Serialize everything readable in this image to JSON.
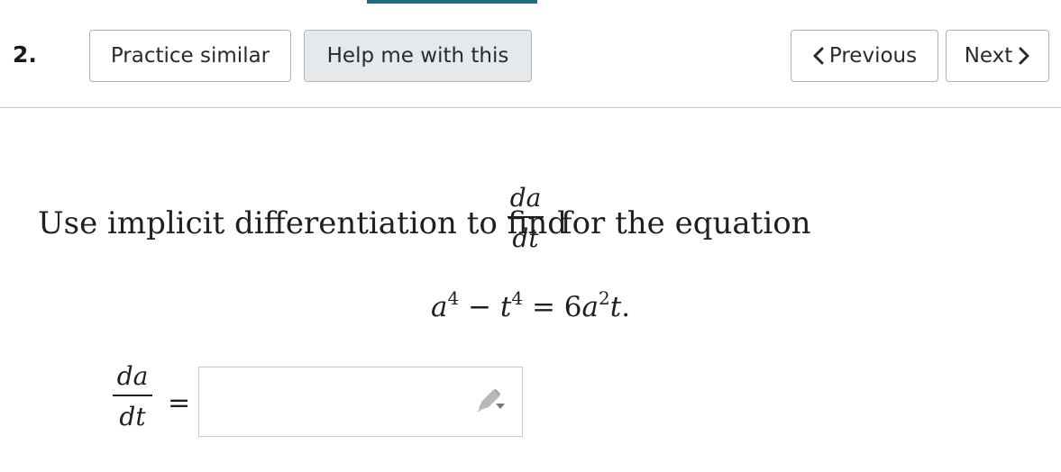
{
  "question": {
    "number": "2."
  },
  "toolbar": {
    "practice_label": "Practice similar",
    "help_label": "Help me with this",
    "previous_label": "Previous",
    "next_label": "Next",
    "previous_icon": "chevron-left-icon",
    "next_icon": "chevron-right-icon"
  },
  "problem": {
    "prompt_before": "Use implicit differentiation to find",
    "derivative_numerator": "da",
    "derivative_denominator": "dt",
    "prompt_after": "for the equation",
    "equation": {
      "a": "a",
      "a_exp": "4",
      "minus": " − ",
      "t": "t",
      "t_exp": "4",
      "equals": " = ",
      "coef": "6",
      "a2": "a",
      "a2_exp": "2",
      "t2": "t",
      "end": "."
    }
  },
  "answer": {
    "label_numerator": "da",
    "label_denominator": "dt",
    "equals": "=",
    "value": "",
    "input_icon": "pencil-edit-icon"
  },
  "colors": {
    "accent": "#1a6e80",
    "help_button_bg": "#e6e9ec",
    "border": "#b3b3b3"
  }
}
